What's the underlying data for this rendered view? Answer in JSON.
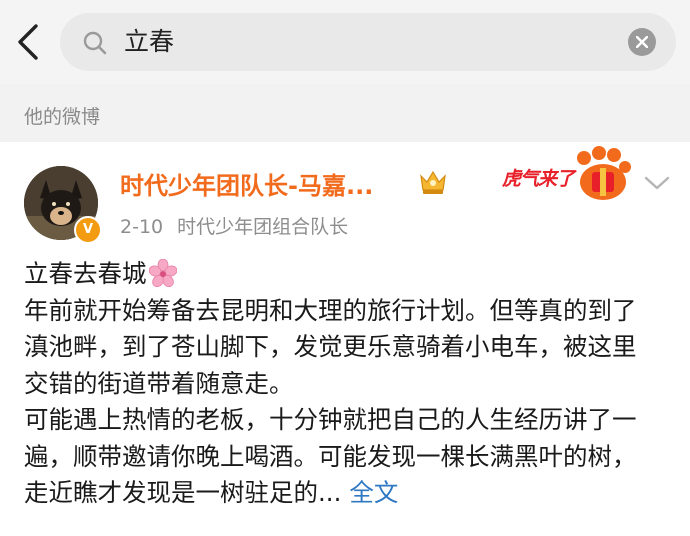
{
  "search": {
    "back_icon": "chevron-left-icon",
    "search_icon": "search-icon",
    "query": "立春",
    "clear_icon": "close-icon"
  },
  "section": {
    "title": "他的微博"
  },
  "post": {
    "author": {
      "name": "时代少年团队长-马嘉...",
      "verified": true,
      "member_badge_icon": "crown-member-icon",
      "verified_icon": "verified-v-icon"
    },
    "date": "2-10",
    "source": "时代少年团组合队长",
    "badge_text": "虎气来了",
    "badge_icon": "tiger-paw-icon",
    "more_icon": "chevron-down-icon",
    "title_line": "立春去春城",
    "title_emoji": "cherry-blossom-icon",
    "paragraph1": "年前就开始筹备去昆明和大理的旅行计划。但等真的到了滇池畔，到了苍山脚下，发觉更乐意骑着小电车，被这里交错的街道带着随意走。",
    "paragraph2": "可能遇上热情的老板，十分钟就把自己的人生经历讲了一遍，顺带邀请你晚上喝酒。可能发现一棵长满黑叶的树，走近瞧才发现是一树驻足的...",
    "expand_label": "全文"
  },
  "colors": {
    "username": "#f26b1d",
    "link": "#2f78c4",
    "meta": "#8d8d8d",
    "badge_red": "#e8202a",
    "verified": "#f39c12"
  }
}
